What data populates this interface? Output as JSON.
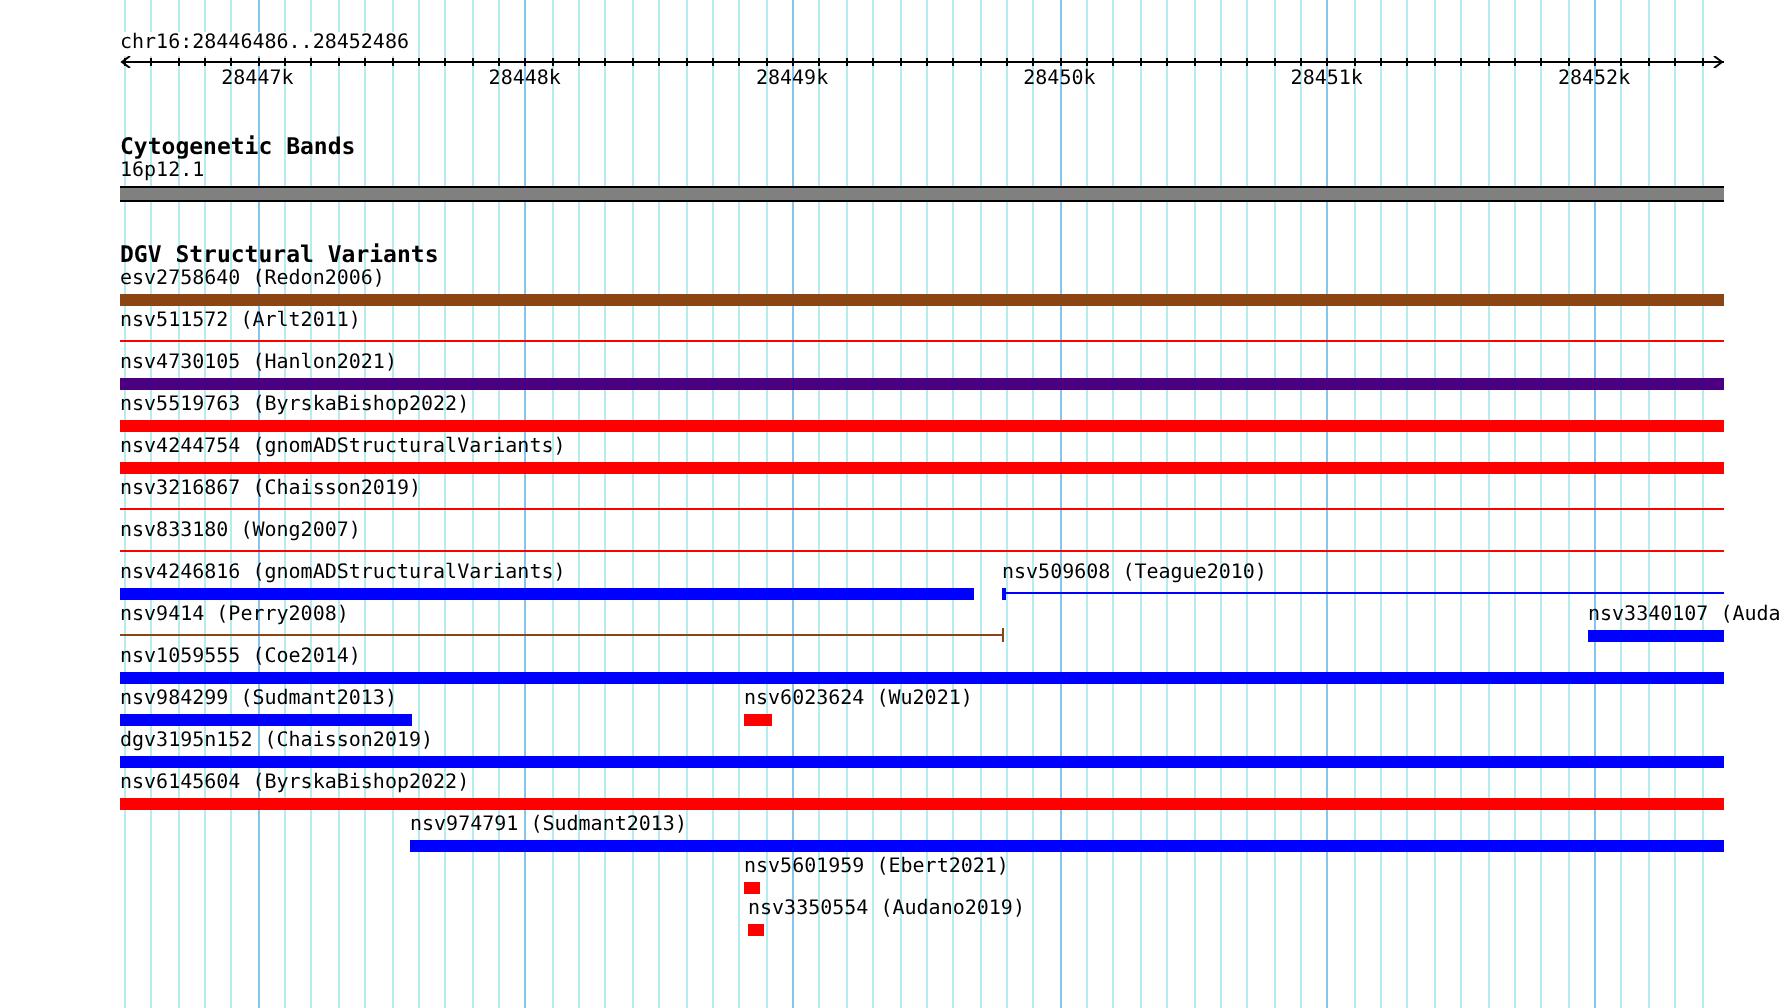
{
  "ruler": {
    "location": "chr16:28446486..28452486",
    "ticks": [
      "28447k",
      "28448k",
      "28449k",
      "28450k",
      "28451k",
      "28452k"
    ]
  },
  "cytogenetic_bands": {
    "title": "Cytogenetic Bands",
    "band": {
      "label": "16p12.1",
      "color": "#808080"
    }
  },
  "variants": {
    "title": "DGV Structural Variants",
    "features": [
      {
        "label": "esv2758640 (Redon2006)",
        "color": "#8b4513",
        "kind": "thick"
      },
      {
        "label": "nsv511572 (Arlt2011)",
        "color": "#ff0000",
        "kind": "thin"
      },
      {
        "label": "nsv4730105 (Hanlon2021)",
        "color": "#4b0082",
        "kind": "thick"
      },
      {
        "label": "nsv5519763 (ByrskaBishop2022)",
        "color": "#ff0000",
        "kind": "thick"
      },
      {
        "label": "nsv4244754 (gnomADStructuralVariants)",
        "color": "#ff0000",
        "kind": "thick"
      },
      {
        "label": "nsv3216867 (Chaisson2019)",
        "color": "#ff0000",
        "kind": "thin"
      },
      {
        "label": "nsv833180 (Wong2007)",
        "color": "#ff0000",
        "kind": "thin"
      },
      {
        "label": "nsv4246816 (gnomADStructuralVariants)",
        "color": "#0000ff",
        "kind": "thick"
      },
      {
        "label": "nsv509608 (Teague2010)",
        "color": "#0000ff",
        "kind": "start-block"
      },
      {
        "label": "nsv9414 (Perry2008)",
        "color": "#8b4513",
        "kind": "end-cap"
      },
      {
        "label": "nsv3340107 (Auda",
        "color": "#0000ff",
        "kind": "thick"
      },
      {
        "label": "nsv1059555 (Coe2014)",
        "color": "#0000ff",
        "kind": "thick"
      },
      {
        "label": "nsv984299 (Sudmant2013)",
        "color": "#0000ff",
        "kind": "thick"
      },
      {
        "label": "nsv6023624 (Wu2021)",
        "color": "#ff0000",
        "kind": "thick"
      },
      {
        "label": "dgv3195n152 (Chaisson2019)",
        "color": "#0000ff",
        "kind": "thick"
      },
      {
        "label": "nsv6145604 (ByrskaBishop2022)",
        "color": "#ff0000",
        "kind": "thick"
      },
      {
        "label": "nsv974791 (Sudmant2013)",
        "color": "#0000ff",
        "kind": "thick"
      },
      {
        "label": "nsv5601959 (Ebert2021)",
        "color": "#ff0000",
        "kind": "thick"
      },
      {
        "label": "nsv3350554 (Audano2019)",
        "color": "#ff0000",
        "kind": "thick"
      }
    ]
  }
}
